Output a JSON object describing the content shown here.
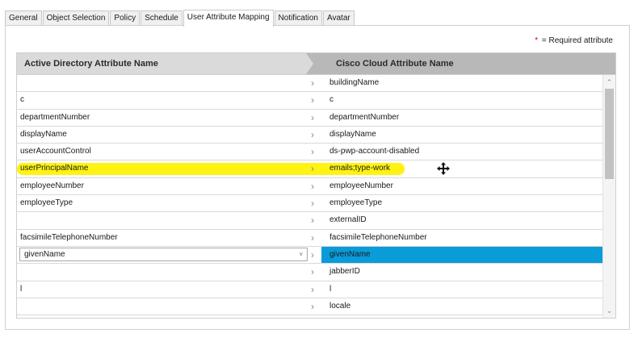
{
  "tabs": [
    {
      "label": "General",
      "active": false
    },
    {
      "label": "Object Selection",
      "active": false
    },
    {
      "label": "Policy",
      "active": false
    },
    {
      "label": "Schedule",
      "active": false
    },
    {
      "label": "User Attribute Mapping",
      "active": true
    },
    {
      "label": "Notification",
      "active": false
    },
    {
      "label": "Avatar",
      "active": false
    }
  ],
  "required_note": {
    "star": "*",
    "text": "= Required attribute"
  },
  "grid": {
    "col_ad": "Active Directory Attribute Name",
    "col_cc": "Cisco Cloud Attribute Name",
    "rows": [
      {
        "ad": "",
        "cc": "buildingName"
      },
      {
        "ad": "c",
        "cc": "c"
      },
      {
        "ad": "departmentNumber",
        "cc": "departmentNumber"
      },
      {
        "ad": "displayName",
        "cc": "displayName"
      },
      {
        "ad": "userAccountControl",
        "cc": "ds-pwp-account-disabled"
      },
      {
        "ad": "userPrincipalName",
        "cc": "emails;type-work",
        "highlighted": true
      },
      {
        "ad": "employeeNumber",
        "cc": "employeeNumber"
      },
      {
        "ad": "employeeType",
        "cc": "employeeType"
      },
      {
        "ad": "",
        "cc": "externalID"
      },
      {
        "ad": "facsimileTelephoneNumber",
        "cc": "facsimileTelephoneNumber"
      },
      {
        "ad": "givenName",
        "cc": "givenName",
        "selected": true,
        "editing": true
      },
      {
        "ad": "",
        "cc": "jabberID"
      },
      {
        "ad": "l",
        "cc": "l"
      },
      {
        "ad": "",
        "cc": "locale"
      }
    ]
  },
  "colors": {
    "highlight": "#fff200",
    "selected": "#0a9bd9",
    "header_right": "#b8b8b8",
    "header_left": "#dadada"
  },
  "icons": {
    "chevron": "chevron-right-icon",
    "move": "move-cursor-icon",
    "scroll_up": "scroll-up-arrow-icon",
    "scroll_down": "scroll-down-arrow-icon",
    "dropdown": "dropdown-caret-icon"
  }
}
